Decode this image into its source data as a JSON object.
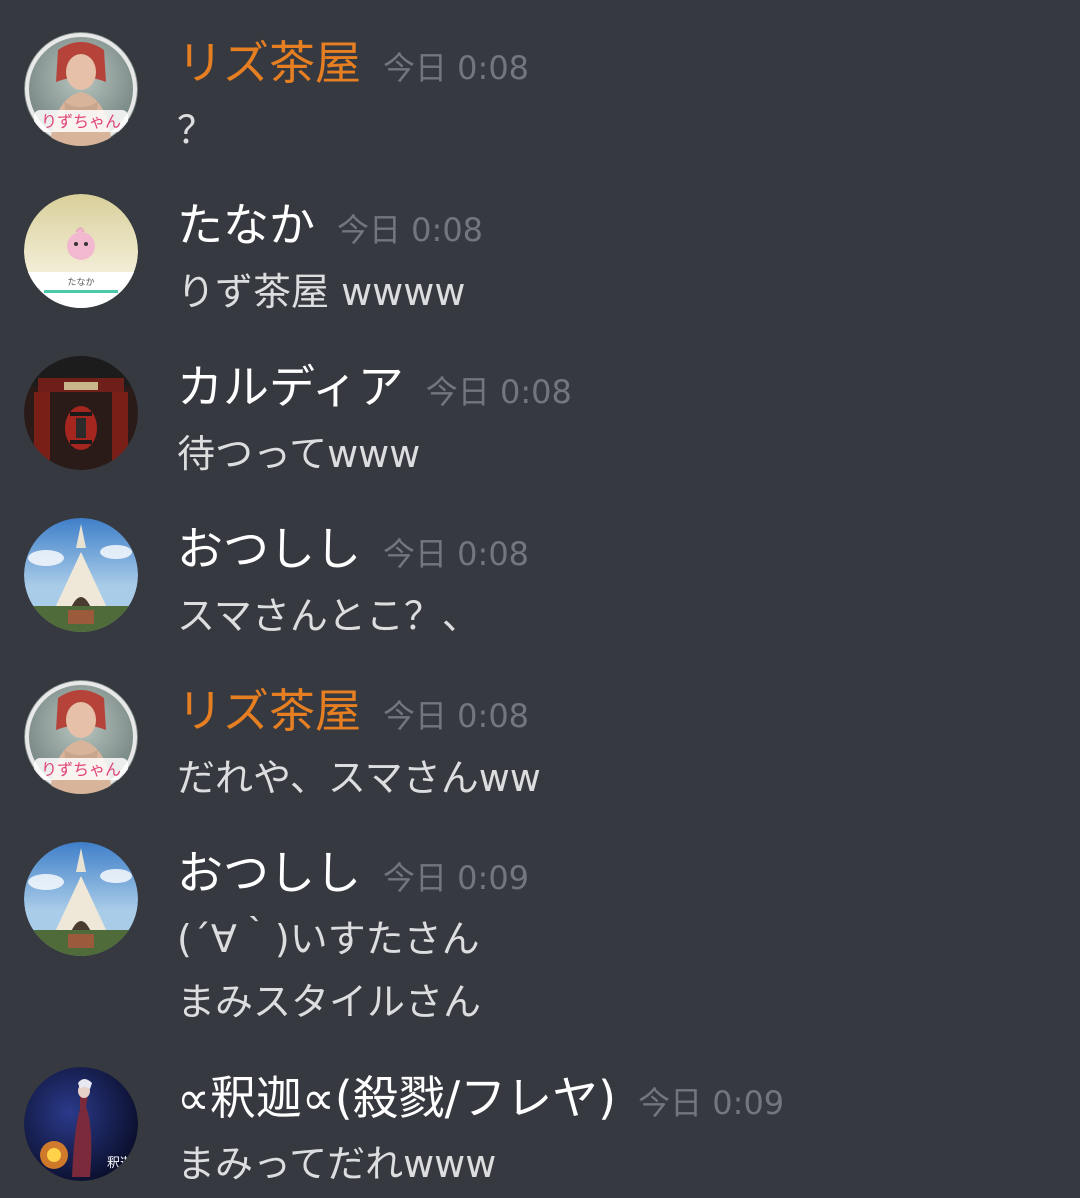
{
  "messages": [
    {
      "author": "リズ茶屋",
      "author_color": "#e67e22",
      "time": "今日 0:08",
      "lines": [
        "？"
      ],
      "avatar_icon": "elf-character-avatar-icon",
      "avatar_text": "りずちゃん"
    },
    {
      "author": "たなか",
      "author_color": "#ffffff",
      "time": "今日 0:08",
      "lines": [
        "りず茶屋 wwww"
      ],
      "avatar_icon": "pink-creature-avatar-icon",
      "avatar_text": "たなか"
    },
    {
      "author": "カルディア",
      "author_color": "#ffffff",
      "time": "今日 0:08",
      "lines": [
        "待つってwww"
      ],
      "avatar_icon": "temple-gate-avatar-icon"
    },
    {
      "author": "おつしし",
      "author_color": "#ffffff",
      "time": "今日 0:08",
      "lines": [
        "スマさんとこ？、"
      ],
      "avatar_icon": "church-avatar-icon"
    },
    {
      "author": "リズ茶屋",
      "author_color": "#e67e22",
      "time": "今日 0:08",
      "lines": [
        "だれや、スマさんww"
      ],
      "avatar_icon": "elf-character-avatar-icon",
      "avatar_text": "りずちゃん"
    },
    {
      "author": "おつしし",
      "author_color": "#ffffff",
      "time": "今日 0:09",
      "lines": [
        "(´∀｀)いすたさん",
        "まみスタイルさん"
      ],
      "avatar_icon": "church-avatar-icon"
    },
    {
      "author": "∝釈迦∝(殺戮/フレヤ)",
      "author_color": "#ffffff",
      "time": "今日 0:09",
      "lines": [
        "まみってだれwww"
      ],
      "avatar_icon": "dark-character-avatar-icon",
      "avatar_text": "釈迦"
    }
  ]
}
